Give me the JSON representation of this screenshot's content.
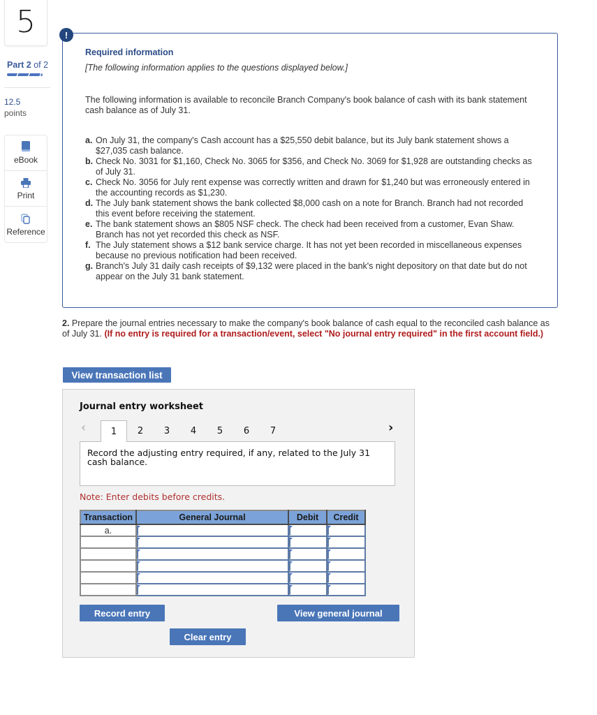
{
  "question": {
    "number": "5",
    "part_current": "Part 2",
    "part_of": "of 2",
    "part_progress": 1.0,
    "points_value": "12.5",
    "points_label": "points"
  },
  "tools": [
    {
      "label": "eBook",
      "icon": "book-icon"
    },
    {
      "label": "Print",
      "icon": "printer-icon"
    },
    {
      "label": "Reference",
      "icon": "copy-pages-icon"
    }
  ],
  "required_info": {
    "badge": "!",
    "title": "Required information",
    "subtitle": "[The following information applies to the questions displayed below.]",
    "intro": "The following information is available to reconcile Branch Company's book balance of cash with its bank statement cash balance as of July 31.",
    "items": [
      {
        "letter": "a.",
        "text": "On July 31, the company's Cash account has a $25,550 debit balance, but its July bank statement shows a $27,035 cash balance."
      },
      {
        "letter": "b.",
        "text": "Check No. 3031 for $1,160, Check No. 3065 for $356, and Check No. 3069 for $1,928 are outstanding checks as of July 31."
      },
      {
        "letter": "c.",
        "text": "Check No. 3056 for July rent expense was correctly written and drawn for $1,240 but was erroneously entered in the accounting records as $1,230."
      },
      {
        "letter": "d.",
        "text": "The July bank statement shows the bank collected $8,000 cash on a note for Branch. Branch had not recorded this event before receiving the statement."
      },
      {
        "letter": "e.",
        "text": "The bank statement shows an $805 NSF check. The check had been received from a customer, Evan Shaw. Branch has not yet recorded this check as NSF."
      },
      {
        "letter": "f.",
        "text": "The July statement shows a $12 bank service charge. It has not yet been recorded in miscellaneous expenses because no previous notification had been received."
      },
      {
        "letter": "g.",
        "text": "Branch's July 31 daily cash receipts of $9,132 were placed in the bank's night depository on that date but do not appear on the July 31 bank statement."
      }
    ]
  },
  "question2": {
    "number": "2.",
    "text": " Prepare the journal entries necessary to make the company's book balance of cash equal to the reconciled cash balance as of July 31. ",
    "instruction": "(If no entry is required for a transaction/event, select \"No journal entry required\" in the first account field.)"
  },
  "buttons": {
    "view_transaction_list": "View transaction list",
    "record_entry": "Record entry",
    "clear_entry": "Clear entry",
    "view_general_journal": "View general journal"
  },
  "worksheet": {
    "title": "Journal entry worksheet",
    "prev_icon": "chevron-left-icon",
    "next_icon": "chevron-right-icon",
    "tabs": [
      "1",
      "2",
      "3",
      "4",
      "5",
      "6",
      "7"
    ],
    "active_tab": "1",
    "description": "Record the adjusting entry required, if any, related to the July 31 cash balance.",
    "note": "Note: Enter debits before credits.",
    "columns": [
      "Transaction",
      "General Journal",
      "Debit",
      "Credit"
    ],
    "rows": [
      {
        "transaction": "a.",
        "account": "",
        "debit": "",
        "credit": ""
      },
      {
        "transaction": "",
        "account": "",
        "debit": "",
        "credit": ""
      },
      {
        "transaction": "",
        "account": "",
        "debit": "",
        "credit": ""
      },
      {
        "transaction": "",
        "account": "",
        "debit": "",
        "credit": ""
      },
      {
        "transaction": "",
        "account": "",
        "debit": "",
        "credit": ""
      },
      {
        "transaction": "",
        "account": "",
        "debit": "",
        "credit": ""
      }
    ]
  },
  "colors": {
    "accent": "#4a76b8",
    "panel_border": "#3a5b9b",
    "warning_red": "#b01c1c",
    "table_header": "#7ba3d9"
  }
}
